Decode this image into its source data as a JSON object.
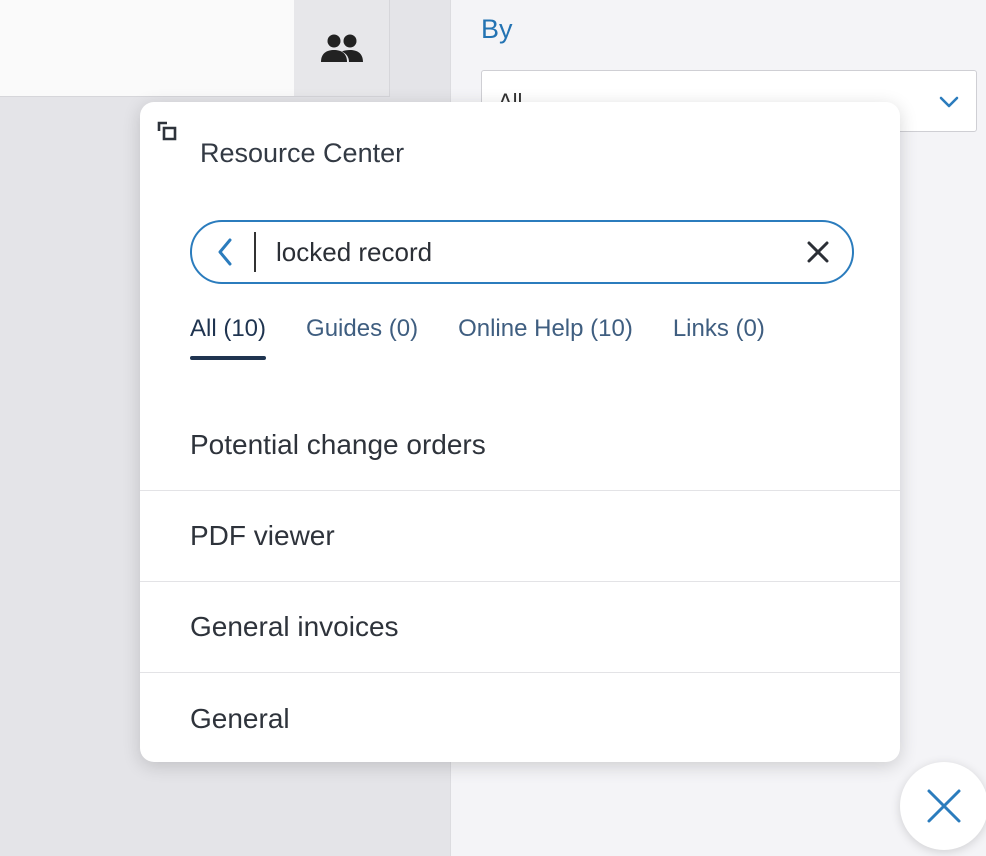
{
  "background": {
    "filter_label": "By",
    "filter_select_value": "All",
    "icons": {
      "users_button": "users-icon",
      "filter_chevron": "chevron-down-icon"
    }
  },
  "resource_center": {
    "title": "Resource Center",
    "search": {
      "value": "locked record",
      "back_icon": "chevron-left-icon",
      "clear_icon": "close-icon"
    },
    "tabs": [
      {
        "label": "All (10)",
        "active": true
      },
      {
        "label": "Guides (0)",
        "active": false
      },
      {
        "label": "Online Help (10)",
        "active": false
      },
      {
        "label": "Links (0)",
        "active": false
      }
    ],
    "results": [
      {
        "label": "Potential change orders"
      },
      {
        "label": "PDF viewer"
      },
      {
        "label": "General invoices"
      },
      {
        "label": "General"
      }
    ]
  },
  "colors": {
    "accent": "#2b7cbd",
    "tab_active": "#1f3450",
    "tab_inactive": "#3f5e80",
    "text": "#2e333b"
  }
}
